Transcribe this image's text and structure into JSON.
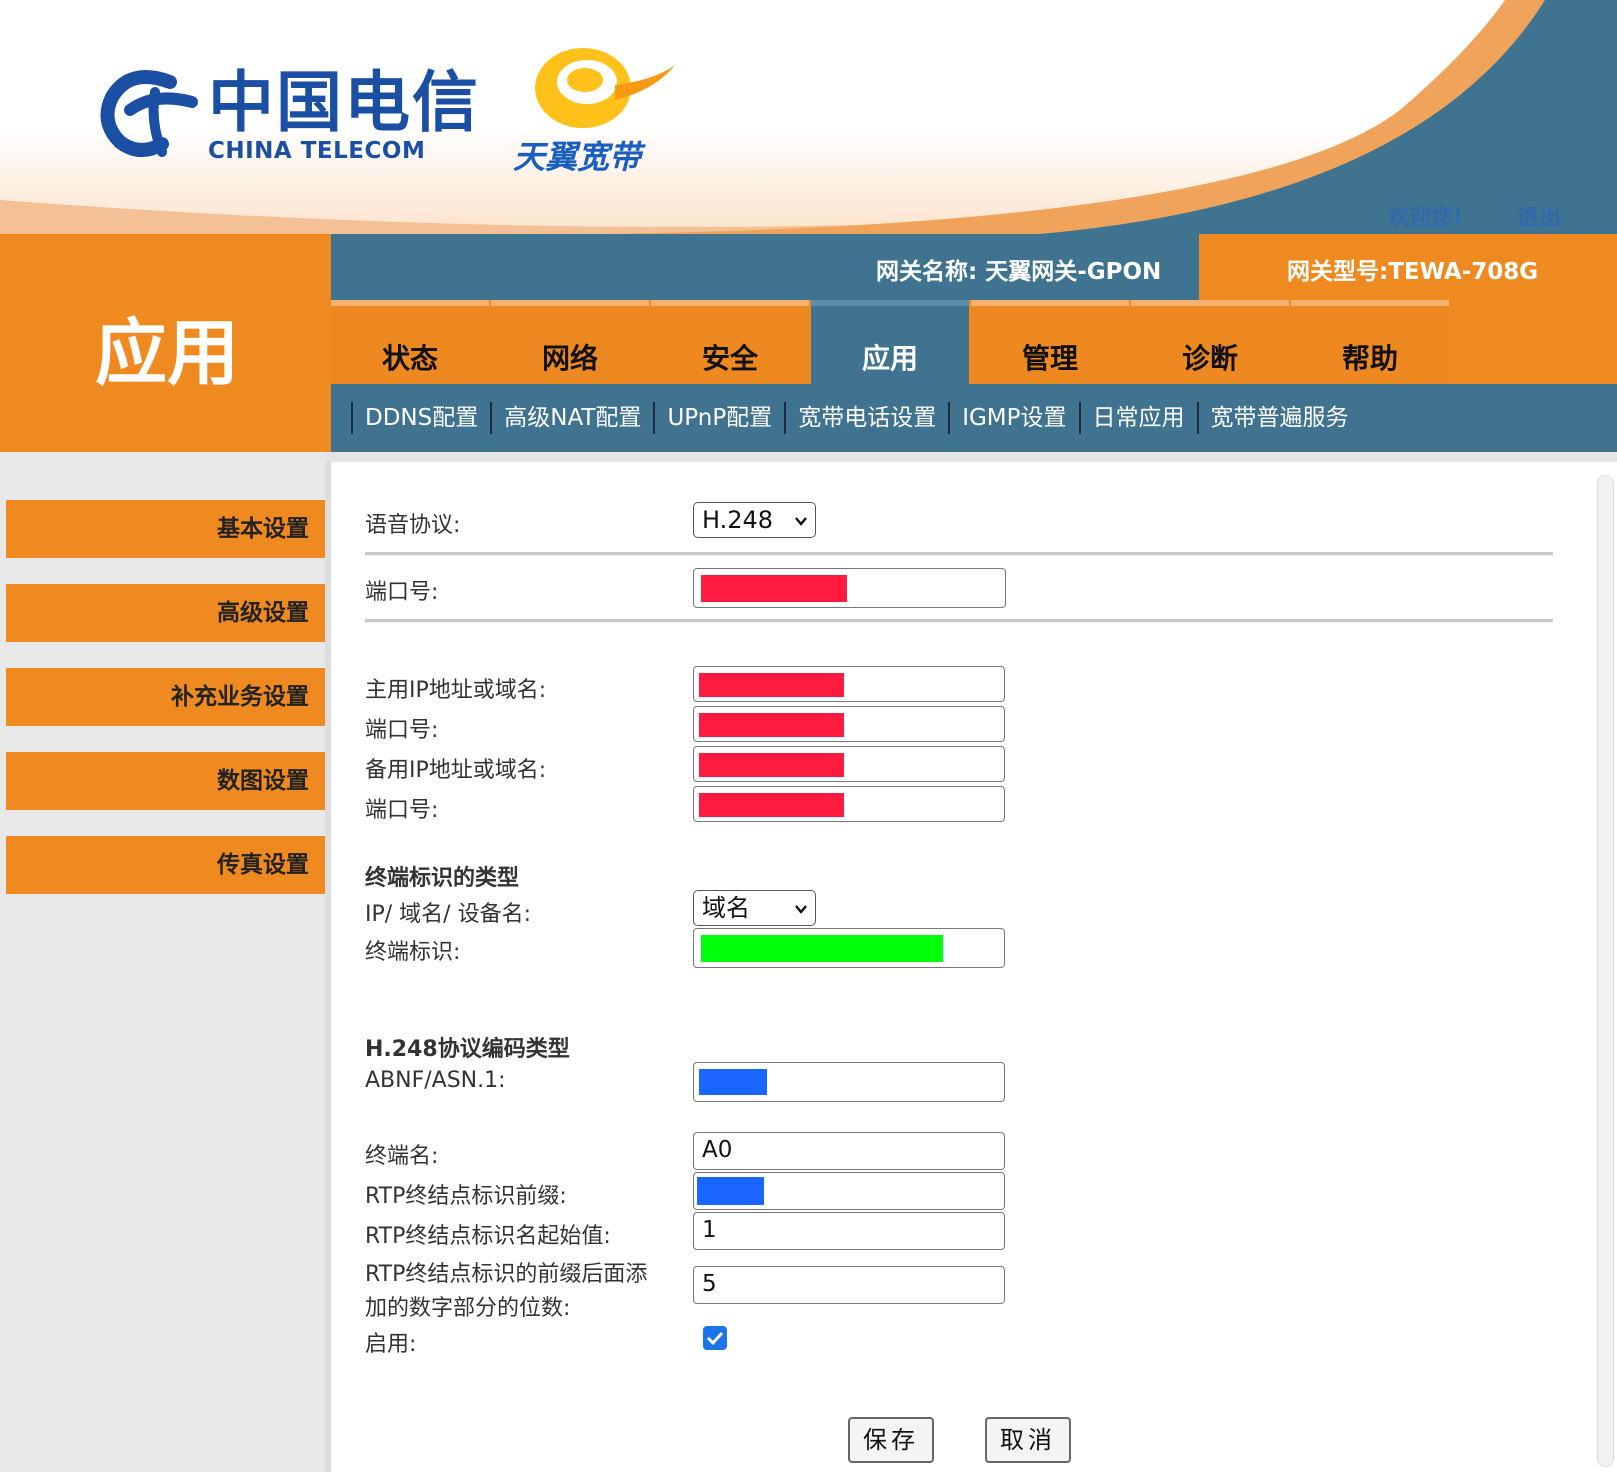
{
  "header": {
    "brand_cn": "中国电信",
    "brand_en": "CHINA TELECOM",
    "sub_brand": "天翼宽带",
    "welcome": "欢迎您!",
    "logout": "退出"
  },
  "section_title": "应用",
  "info_bar": {
    "gateway_name": "网关名称:  天翼网关-GPON",
    "gateway_model": "网关型号:TEWA-708G"
  },
  "tabs": [
    {
      "label": "状态"
    },
    {
      "label": "网络"
    },
    {
      "label": "安全"
    },
    {
      "label": "应用"
    },
    {
      "label": "管理"
    },
    {
      "label": "诊断"
    },
    {
      "label": "帮助"
    }
  ],
  "active_tab": "应用",
  "subnav": [
    {
      "label": "DDNS配置"
    },
    {
      "label": "高级NAT配置"
    },
    {
      "label": "UPnP配置"
    },
    {
      "label": "宽带电话设置"
    },
    {
      "label": "IGMP设置"
    },
    {
      "label": "日常应用"
    },
    {
      "label": "宽带普遍服务"
    }
  ],
  "sidebar": [
    {
      "label": "基本设置"
    },
    {
      "label": "高级设置"
    },
    {
      "label": "补充业务设置"
    },
    {
      "label": "数图设置"
    },
    {
      "label": "传真设置"
    }
  ],
  "form": {
    "voice_protocol_label": "语音协议:",
    "voice_protocol_value": "H.248",
    "port_label": "端口号:",
    "primary_ip_label": "主用IP地址或域名:",
    "port2_label": "端口号:",
    "backup_ip_label": "备用IP地址或域名:",
    "port3_label": "端口号:",
    "terminal_id_type_heading": "终端标识的类型",
    "terminal_id_type_label": "IP/ 域名/ 设备名:",
    "terminal_id_type_value": "域名",
    "terminal_id_label": "终端标识:",
    "encoding_heading": "H.248协议编码类型",
    "encoding_label": "ABNF/ASN.1:",
    "terminal_name_label": "终端名:",
    "terminal_name_value": "A0",
    "rtp_prefix_label": "RTP终结点标识前缀:",
    "rtp_start_label": "RTP终结点标识名起始值:",
    "rtp_start_value": "1",
    "rtp_digits_label_line1": "RTP终结点标识的前缀后面添",
    "rtp_digits_label_line2": "加的数字部分的位数:",
    "rtp_digits_value": "5",
    "enable_label": "启用:",
    "enable_checked": true
  },
  "buttons": {
    "save": "保存",
    "cancel": "取消"
  },
  "colors": {
    "orange": "#ef8a20",
    "steel_blue": "#3f7390",
    "redaction_red": "#ff1a40",
    "redaction_green": "#00ff0a",
    "redaction_blue": "#1a66ff"
  }
}
